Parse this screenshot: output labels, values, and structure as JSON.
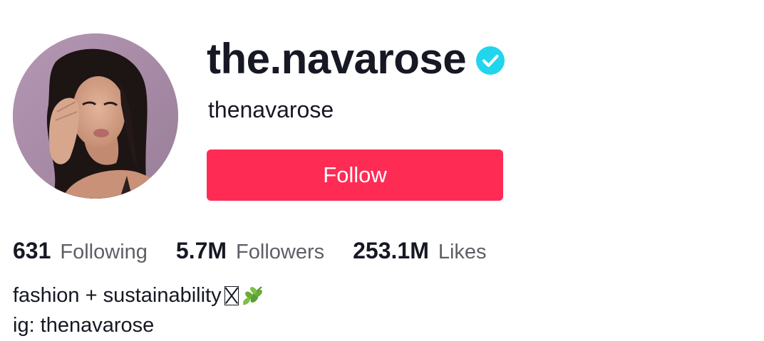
{
  "profile": {
    "display_name": "the.navarose",
    "username": "thenavarose",
    "verified_icon": "verified-badge-icon",
    "avatar_icon": "profile-avatar"
  },
  "actions": {
    "follow_label": "Follow"
  },
  "stats": [
    {
      "value": "631",
      "label": "Following"
    },
    {
      "value": "5.7M",
      "label": "Followers"
    },
    {
      "value": "253.1M",
      "label": "Likes"
    }
  ],
  "bio": {
    "line1": "fashion + sustainability",
    "line1_icons": [
      "missing-glyph-icon",
      "herb-leaf-icon"
    ],
    "line2": "ig: thenavarose"
  },
  "colors": {
    "accent": "#fe2c55",
    "verified": "#20d5ec",
    "text_primary": "#161823",
    "text_secondary": "#5e5f66"
  }
}
